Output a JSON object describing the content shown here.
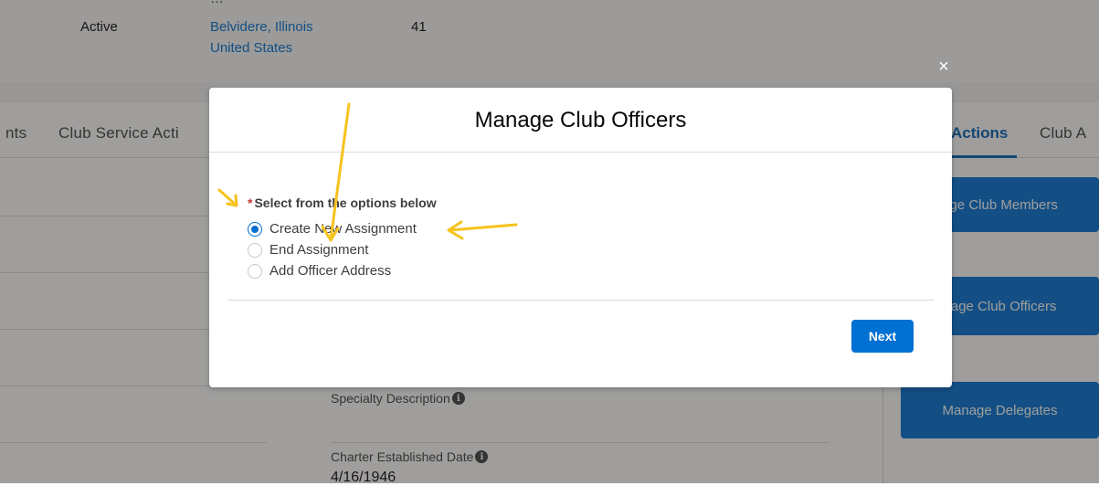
{
  "header": {
    "status": "Active",
    "location_line1": "Belvidere, Illinois",
    "location_line2": "United States",
    "count": "41"
  },
  "tabs": {
    "left_cut": "nts",
    "service": "Club Service Acti",
    "actions": "Actions",
    "right_cut": "Club A"
  },
  "fields": {
    "specialty_label": "Specialty Description",
    "charter_label": "Charter Established Date",
    "charter_value": "4/16/1946"
  },
  "actions": {
    "members": "age Club Members",
    "officers": "nage Club Officers",
    "delegates": "Manage Delegates"
  },
  "modal": {
    "close_glyph": "×",
    "title": "Manage Club Officers",
    "required_mark": "*",
    "prompt": "Select from the options below",
    "options": [
      {
        "label": "Create New Assignment",
        "selected": true
      },
      {
        "label": "End Assignment",
        "selected": false
      },
      {
        "label": "Add Officer Address",
        "selected": false
      }
    ],
    "next_label": "Next"
  },
  "icons": {
    "info": "info-icon",
    "close": "close-icon"
  },
  "colors": {
    "brand": "#0070d2",
    "required": "#c23934",
    "annotation": "#f6c31c"
  }
}
